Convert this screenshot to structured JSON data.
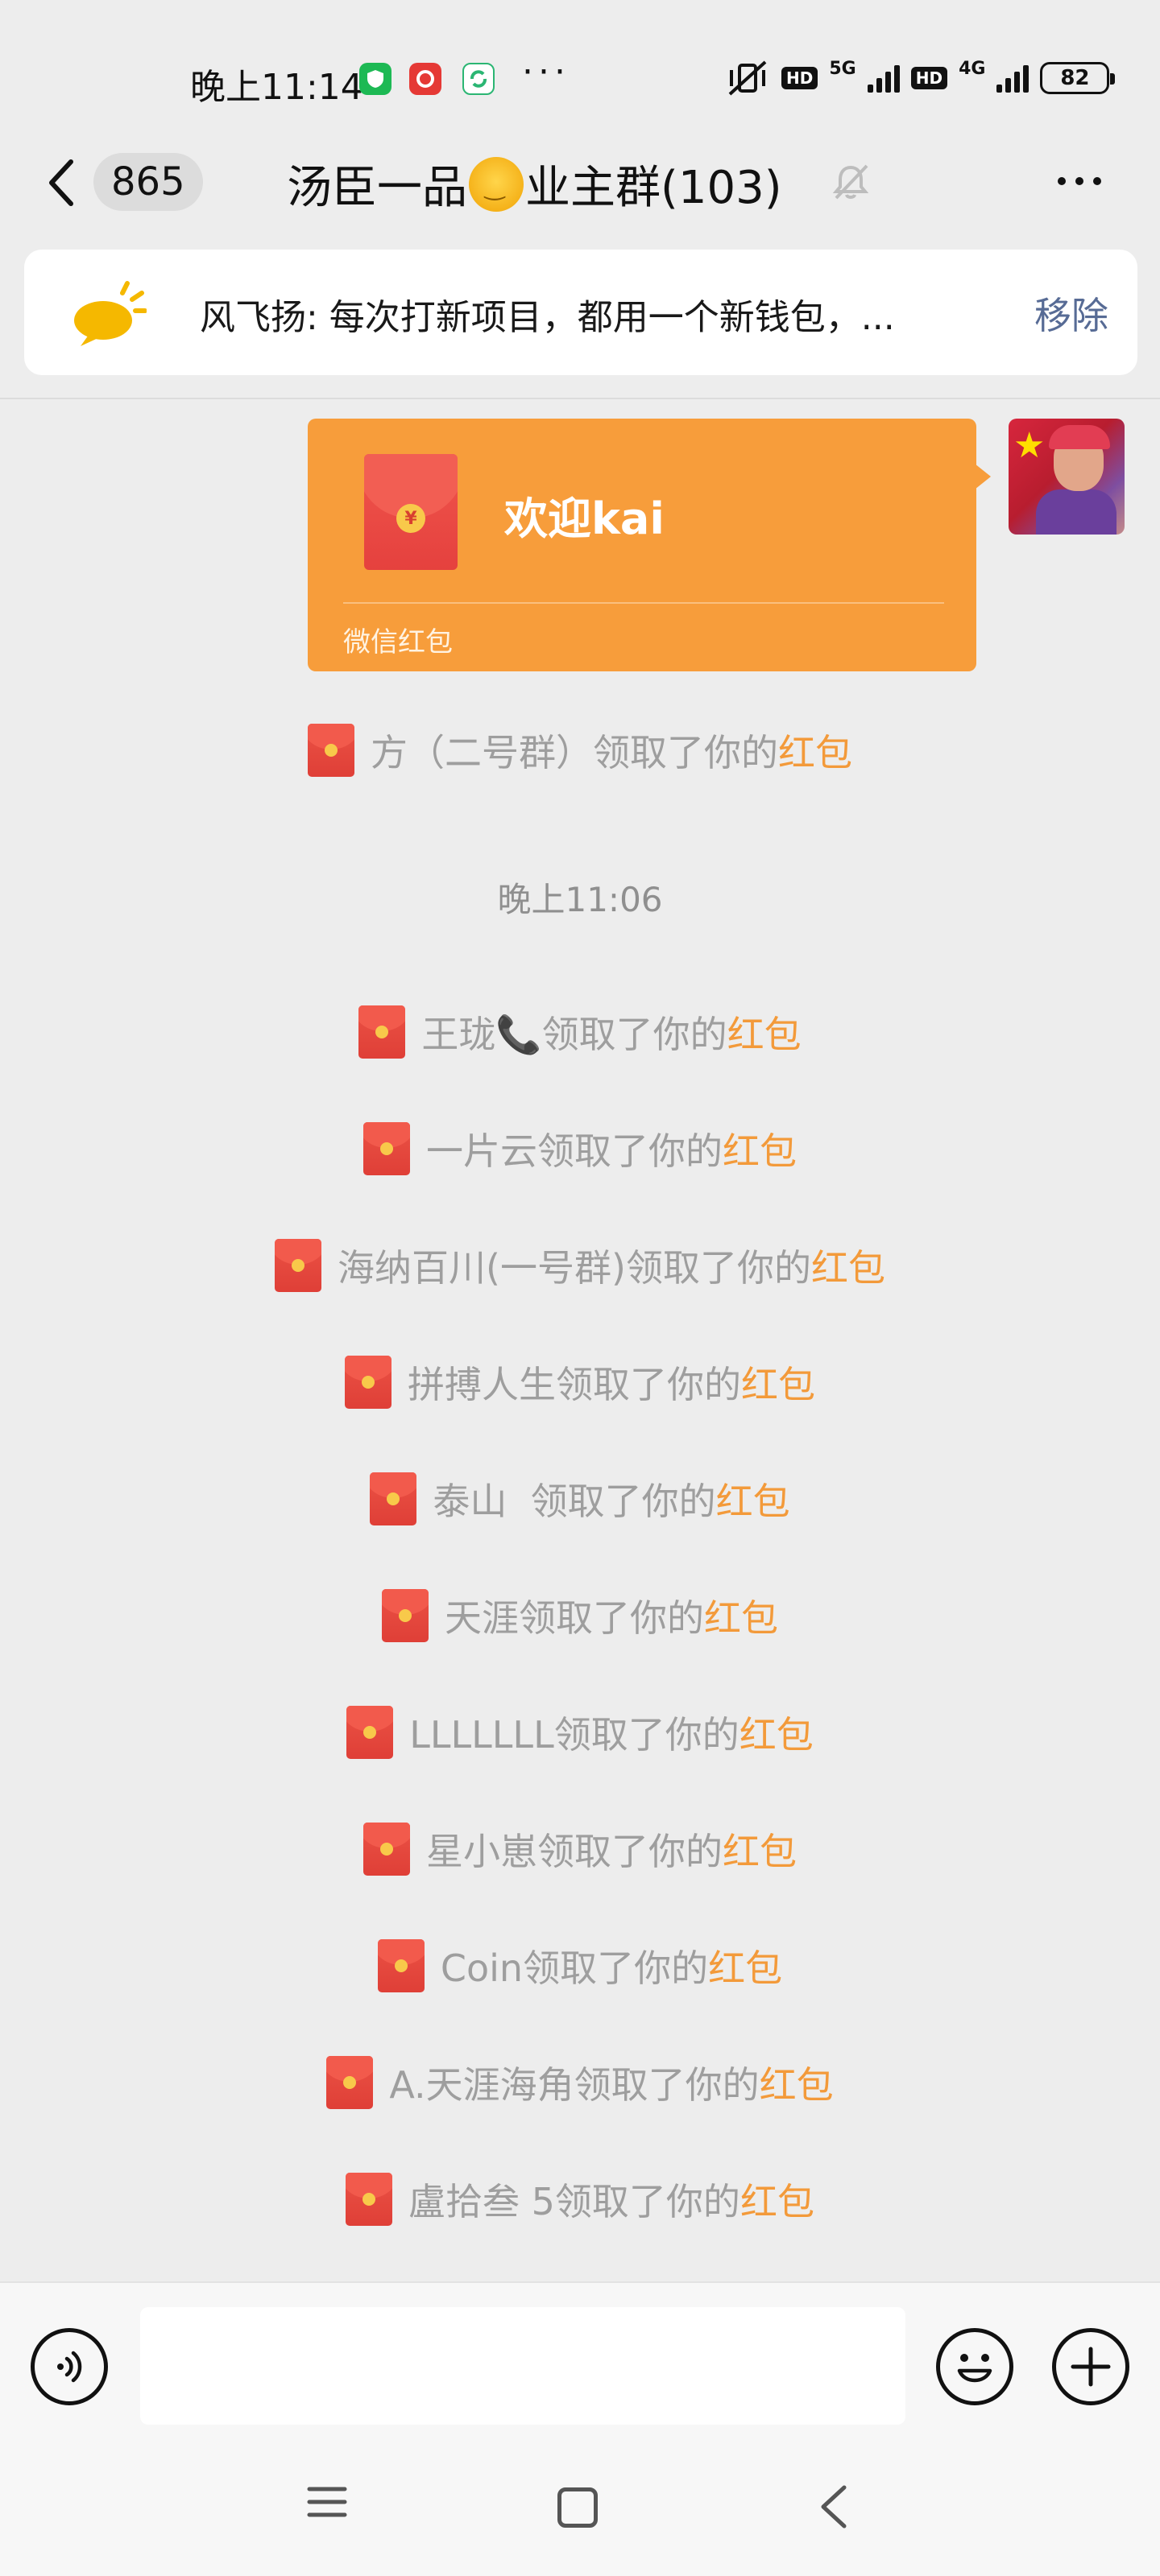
{
  "status_bar": {
    "time": "晚上11:14",
    "network_1": "5G",
    "network_2": "4G",
    "hd": "HD",
    "battery": "82",
    "more": "···"
  },
  "nav": {
    "unread_count": "865",
    "title_part1": "汤臣一品",
    "title_part2": "业主群(103)"
  },
  "notice": {
    "text": "风飞扬: 每次打新项目，都用一个新钱包，...",
    "remove_label": "移除"
  },
  "red_packet": {
    "title": "欢迎kai",
    "footer": "微信红包",
    "coin": "¥"
  },
  "first_receipt": {
    "text": "方（二号群）领取了你的",
    "link": "红包"
  },
  "timestamp": "晚上11:06",
  "receipts": [
    {
      "text": "王珑📞领取了你的",
      "link": "红包"
    },
    {
      "text": "一片云领取了你的",
      "link": "红包"
    },
    {
      "text": "海纳百川(一号群)领取了你的",
      "link": "红包"
    },
    {
      "text": "拼搏人生领取了你的",
      "link": "红包"
    },
    {
      "text": "泰山  领取了你的",
      "link": "红包"
    },
    {
      "text": "天涯领取了你的",
      "link": "红包"
    },
    {
      "text": "LLLLLLL领取了你的",
      "link": "红包"
    },
    {
      "text": "星小崽领取了你的",
      "link": "红包"
    },
    {
      "text": "Coin领取了你的",
      "link": "红包"
    },
    {
      "text": "A.天涯海角领取了你的",
      "link": "红包"
    },
    {
      "text": "盧拾叁 5领取了你的",
      "link": "红包"
    }
  ],
  "input": {
    "value": ""
  },
  "colors": {
    "packet_orange": "#f79d3b",
    "link_orange": "#f39a3a",
    "background": "#ededed",
    "remove_blue": "#576b95"
  }
}
